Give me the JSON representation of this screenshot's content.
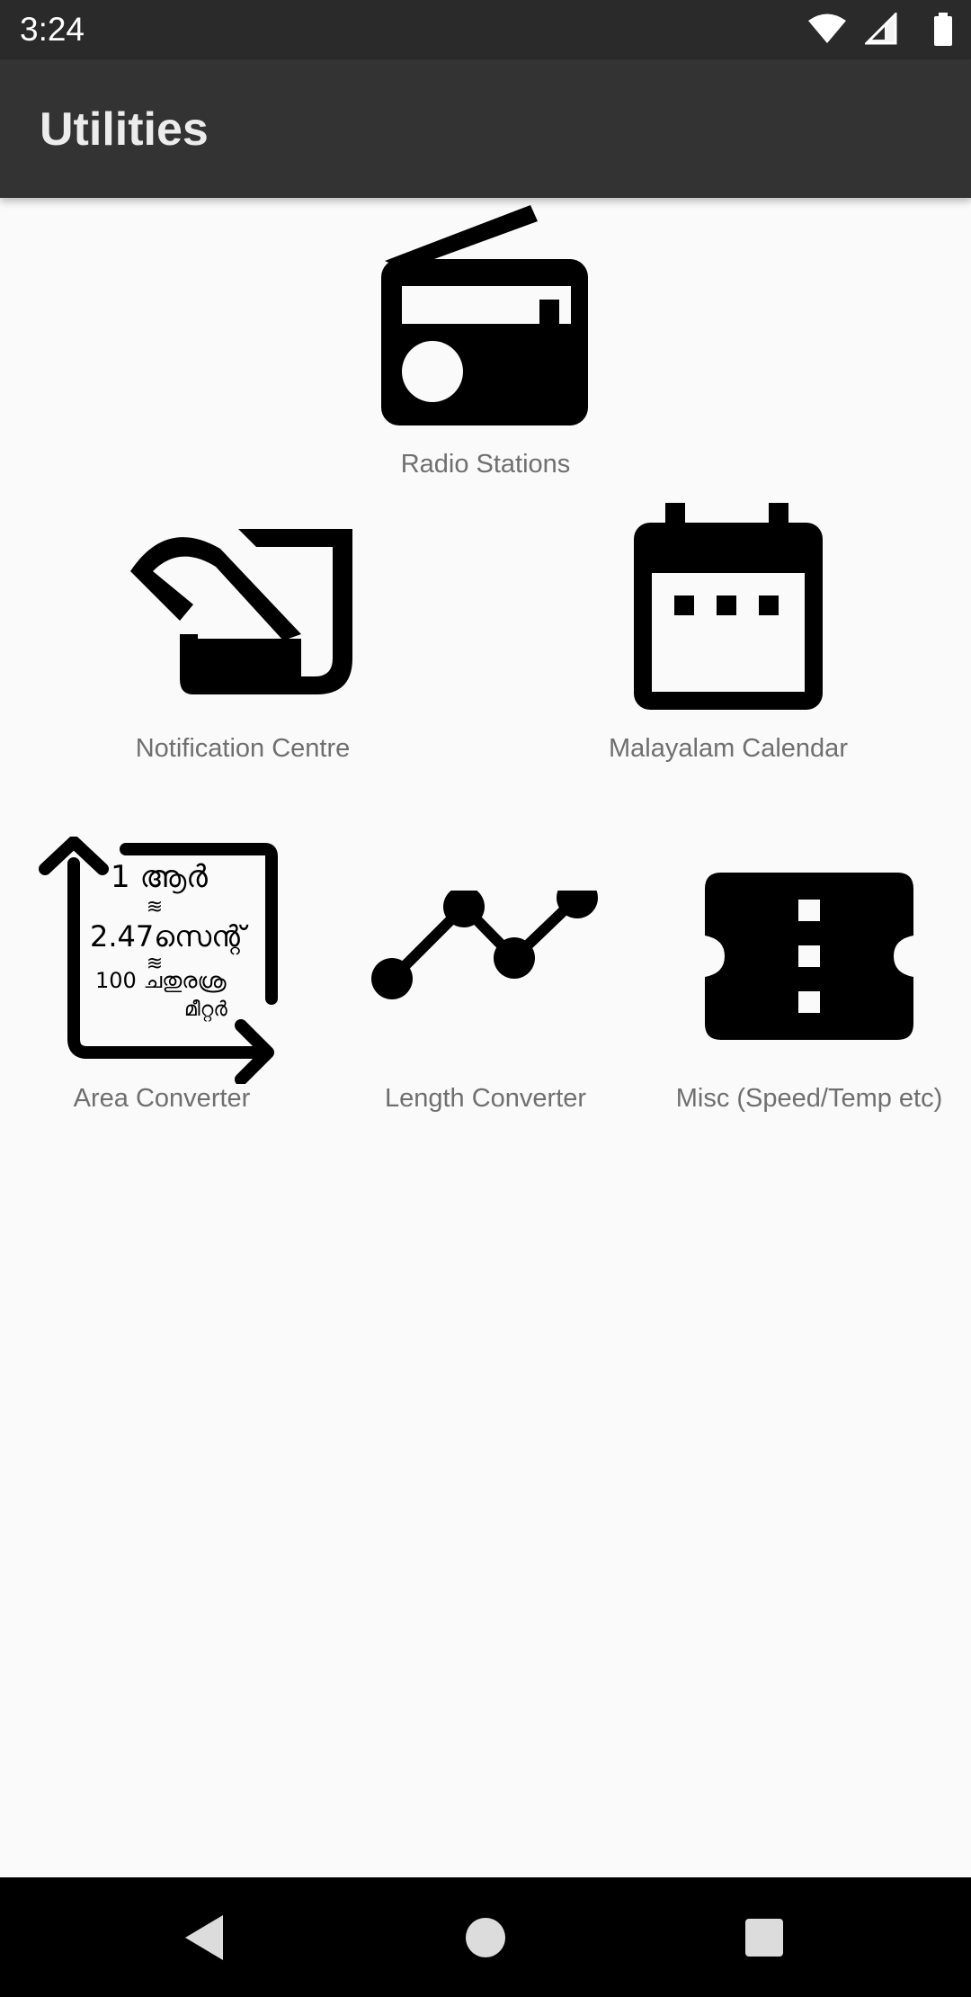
{
  "status_bar": {
    "time": "3:24",
    "icons": [
      "wifi-icon",
      "cell-signal-icon",
      "battery-icon"
    ]
  },
  "app_bar": {
    "title": "Utilities"
  },
  "tiles": [
    {
      "label": "Radio Stations",
      "icon": "radio-icon"
    },
    {
      "label": "Notification Centre",
      "icon": "notification-centre-icon"
    },
    {
      "label": "Malayalam Calendar",
      "icon": "calendar-icon"
    },
    {
      "label": "Area Converter",
      "icon": "area-converter-icon",
      "icon_text": {
        "line1": "1 ആർ",
        "approx1": "≋",
        "line2": "2.47സെന്റ്",
        "approx2": "≋",
        "line3": "100 ചതുരശ്ര",
        "line4": "മീറ്റർ"
      }
    },
    {
      "label": "Length Converter",
      "icon": "line-chart-icon"
    },
    {
      "label": "Misc (Speed/Temp etc)",
      "icon": "ticket-icon"
    }
  ],
  "nav_bar": {
    "buttons": [
      "back",
      "home",
      "recents"
    ]
  },
  "colors": {
    "status_bar": "#2a2a2a",
    "app_bar": "#333333",
    "background": "#fafafa",
    "label": "#6f6f6f",
    "icon": "#000000",
    "nav_bar": "#000000"
  }
}
